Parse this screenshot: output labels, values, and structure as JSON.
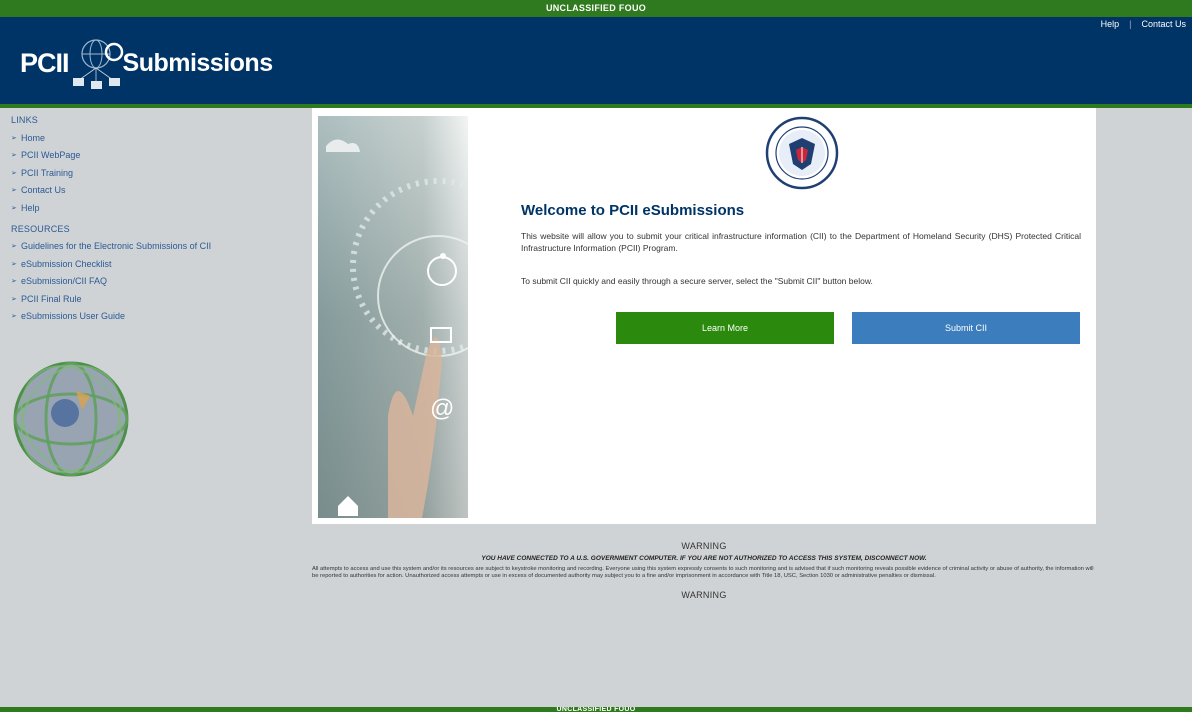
{
  "classification": "UNCLASSIFIED FOUO",
  "logo": {
    "left": "PCII",
    "right": "Submissions"
  },
  "top_links": {
    "help": "Help",
    "contact": "Contact Us"
  },
  "sidebar": {
    "links_header": "LINKS",
    "links": [
      "Home",
      "PCII WebPage",
      "PCII Training",
      "Contact Us",
      "Help"
    ],
    "resources_header": "RESOURCES",
    "resources": [
      "Guidelines for the Electronic Submissions of CII",
      "eSubmission Checklist",
      "eSubmission/CII FAQ",
      "PCII Final Rule",
      "eSubmissions User Guide"
    ]
  },
  "main": {
    "title": "Welcome to PCII eSubmissions",
    "description": "This website will allow you to submit your critical infrastructure information (CII) to the Department of Homeland Security (DHS) Protected Critical Infrastructure Information (PCII) Program.",
    "instruction": "To submit CII quickly and easily through a secure server, select the \"Submit CII\" button below.",
    "learn_more": "Learn More",
    "submit_cii": "Submit CII"
  },
  "warning": {
    "title": "WARNING",
    "headline": "YOU HAVE CONNECTED TO A U.S. GOVERNMENT COMPUTER. IF YOU ARE NOT AUTHORIZED TO ACCESS THIS SYSTEM, DISCONNECT NOW.",
    "body": "All attempts to access and use this system and/or its resources are subject to keystroke monitoring and recording. Everyone using this system expressly consents to such monitoring and is advised that if such monitoring reveals possible evidence of criminal activity or abuse of authority, the information will be reported to authorities for action. Unauthorized access attempts or use in excess of documented authority may subject you to a fine and/or imprisonment in accordance with Title 18, USC, Section 1030 or administrative penalties or dismissal.",
    "footer_title": "WARNING"
  },
  "colors": {
    "header_blue": "#003366",
    "class_green": "#2f7a1e",
    "learn_green": "#2b8a0d",
    "submit_blue": "#3b7dbd"
  },
  "icons": [
    "seal-icon",
    "globe-icon",
    "logo-network-icon",
    "arrow-icon"
  ]
}
